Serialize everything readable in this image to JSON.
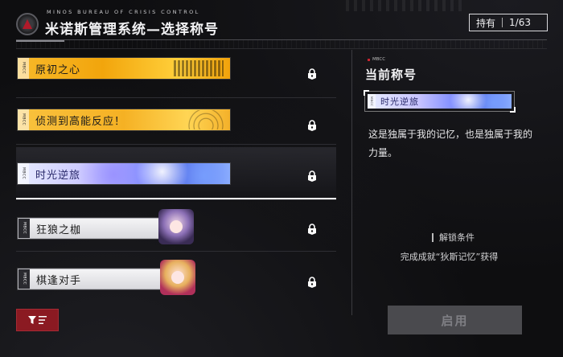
{
  "header": {
    "org_name": "MINOS BUREAU OF CRISIS CONTROL",
    "title": "米诺斯管理系统—选择称号",
    "owned_label": "持有",
    "owned_count": "1/63"
  },
  "titles": [
    {
      "label": "原初之心",
      "style": "gold",
      "tag": "MBCC",
      "locked": true,
      "selected": false
    },
    {
      "label": "侦测到高能反应！",
      "style": "gold2",
      "tag": "MBCC",
      "locked": true,
      "selected": false
    },
    {
      "label": "时光逆旅",
      "style": "blue",
      "tag": "MBCC",
      "locked": true,
      "selected": true
    },
    {
      "label": "狂狼之枷",
      "style": "white",
      "tag": "MBCC",
      "locked": true,
      "selected": false
    },
    {
      "label": "棋逢对手",
      "style": "white",
      "tag": "MBCC",
      "locked": true,
      "selected": false
    }
  ],
  "panel": {
    "tag": "MBCC",
    "heading": "当前称号",
    "current_title": "时光逆旅",
    "description": "这是独属于我的记忆，也是独属于我的力量。",
    "unlock_heading": "解锁条件",
    "unlock_condition": "完成成就“狄斯记忆”获得",
    "enable_button": "启用"
  },
  "icons": {
    "lock": "lock-icon",
    "filter": "filter-icon",
    "logo": "bureau-logo-icon"
  },
  "colors": {
    "accent_red": "#8b1a22",
    "gold": "#f5b124",
    "blue": "#7f8dff",
    "disabled": "#4a4a4e"
  }
}
